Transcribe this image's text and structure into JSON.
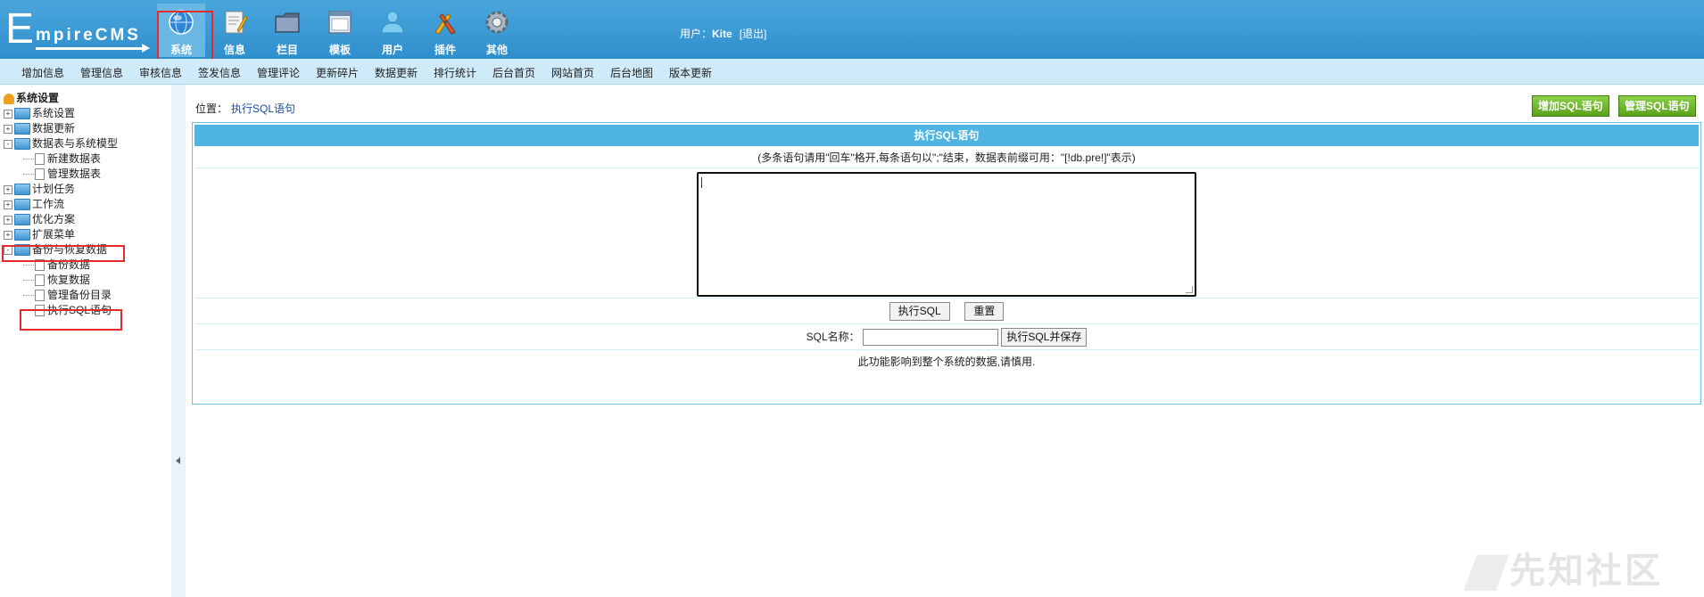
{
  "header": {
    "logo_big": "E",
    "logo_rest": "mpireCMS",
    "nav": [
      {
        "label": "系统",
        "icon": "globe-icon",
        "active": true
      },
      {
        "label": "信息",
        "icon": "edit-document-icon"
      },
      {
        "label": "栏目",
        "icon": "folder-icon"
      },
      {
        "label": "模板",
        "icon": "window-template-icon"
      },
      {
        "label": "用户",
        "icon": "user-icon"
      },
      {
        "label": "插件",
        "icon": "tools-icon"
      },
      {
        "label": "其他",
        "icon": "gear-icon"
      }
    ],
    "user_label": "用户：",
    "user_name": "Kite",
    "logout": "[退出]"
  },
  "submenu": [
    "增加信息",
    "管理信息",
    "审核信息",
    "签发信息",
    "管理评论",
    "更新碎片",
    "数据更新",
    "排行统计",
    "后台首页",
    "网站首页",
    "后台地图",
    "版本更新"
  ],
  "sidebar": {
    "root": "系统设置",
    "items": [
      {
        "label": "系统设置",
        "type": "folder",
        "toggle": "+"
      },
      {
        "label": "数据更新",
        "type": "folder",
        "toggle": "+"
      },
      {
        "label": "数据表与系统模型",
        "type": "folder",
        "toggle": "-"
      },
      {
        "label": "新建数据表",
        "type": "page"
      },
      {
        "label": "管理数据表",
        "type": "page"
      },
      {
        "label": "计划任务",
        "type": "folder",
        "toggle": "+"
      },
      {
        "label": "工作流",
        "type": "folder",
        "toggle": "+"
      },
      {
        "label": "优化方案",
        "type": "folder",
        "toggle": "+"
      },
      {
        "label": "扩展菜单",
        "type": "folder",
        "toggle": "+"
      },
      {
        "label": "备份与恢复数据",
        "type": "folder",
        "toggle": "-"
      },
      {
        "label": "备份数据",
        "type": "page"
      },
      {
        "label": "恢复数据",
        "type": "page"
      },
      {
        "label": "管理备份目录",
        "type": "page"
      },
      {
        "label": "执行SQL语句",
        "type": "page"
      }
    ]
  },
  "main": {
    "breadcrumb_label": "位置：",
    "breadcrumb_current": "执行SQL语句",
    "buttons": {
      "add_sql": "增加SQL语句",
      "manage_sql": "管理SQL语句"
    },
    "panel_title": "执行SQL语句",
    "hint": "(多条语句请用\"回车\"格开,每条语句以\";\"结束，数据表前缀可用：\"[!db.pre!]\"表示)",
    "sql_value": "",
    "exec_button": "执行SQL",
    "reset_button": "重置",
    "sql_name_label": "SQL名称：",
    "sql_name_value": "",
    "exec_save_button": "执行SQL并保存",
    "warning": "此功能影响到整个系统的数据,请慎用."
  },
  "watermark": "先知社区"
}
